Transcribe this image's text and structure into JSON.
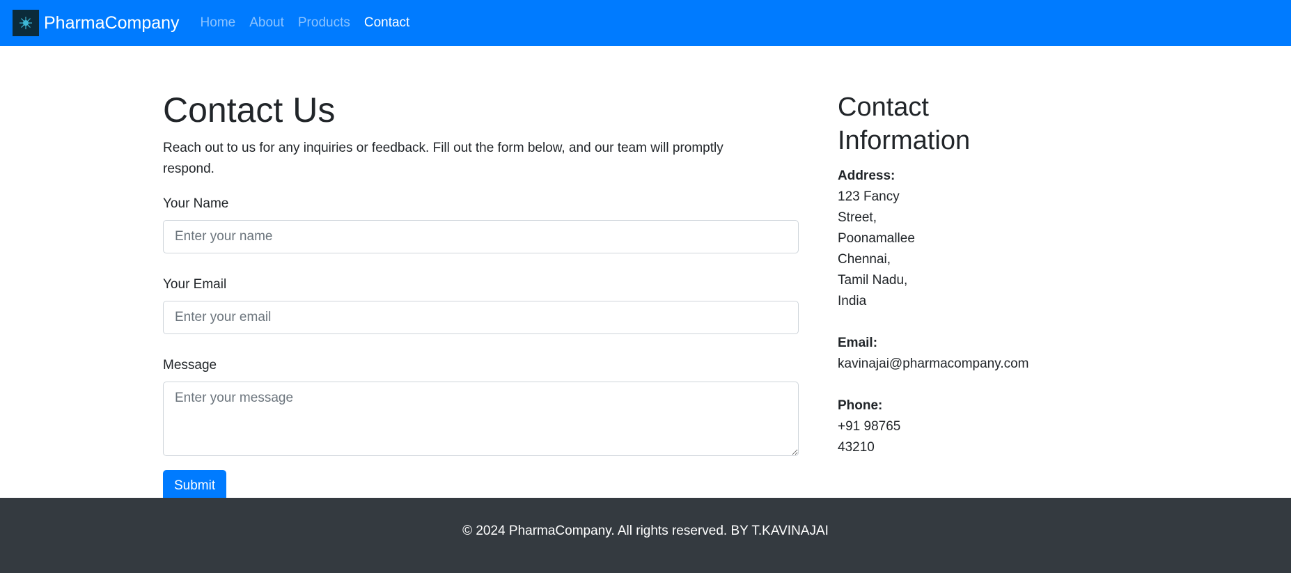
{
  "navbar": {
    "brand": "PharmaCompany",
    "links": [
      {
        "label": "Home"
      },
      {
        "label": "About"
      },
      {
        "label": "Products"
      },
      {
        "label": "Contact"
      }
    ],
    "active_link": "Contact",
    "bg_color": "#007bff"
  },
  "contact_form": {
    "title": "Contact Us",
    "intro": "Reach out to us for any inquiries or feedback. Fill out the form below, and our team will promptly respond.",
    "name_label": "Your Name",
    "name_placeholder": "Enter your name",
    "email_label": "Your Email",
    "email_placeholder": "Enter your email",
    "message_label": "Message",
    "message_placeholder": "Enter your message",
    "submit_label": "Submit"
  },
  "contact_info": {
    "title": "Contact Information",
    "address_label": "Address:",
    "address_lines": [
      "123 Fancy",
      "Street,",
      "Poonamallee",
      "Chennai,",
      "Tamil Nadu,",
      "India"
    ],
    "email_label": "Email:",
    "email_value": "kavinajai@pharmacompany.com",
    "phone_label": "Phone:",
    "phone_lines": [
      "+91 98765",
      "43210"
    ]
  },
  "footer": {
    "text": "© 2024 PharmaCompany. All rights reserved. BY T.KAVINAJAI",
    "bg_color": "#343a40"
  }
}
